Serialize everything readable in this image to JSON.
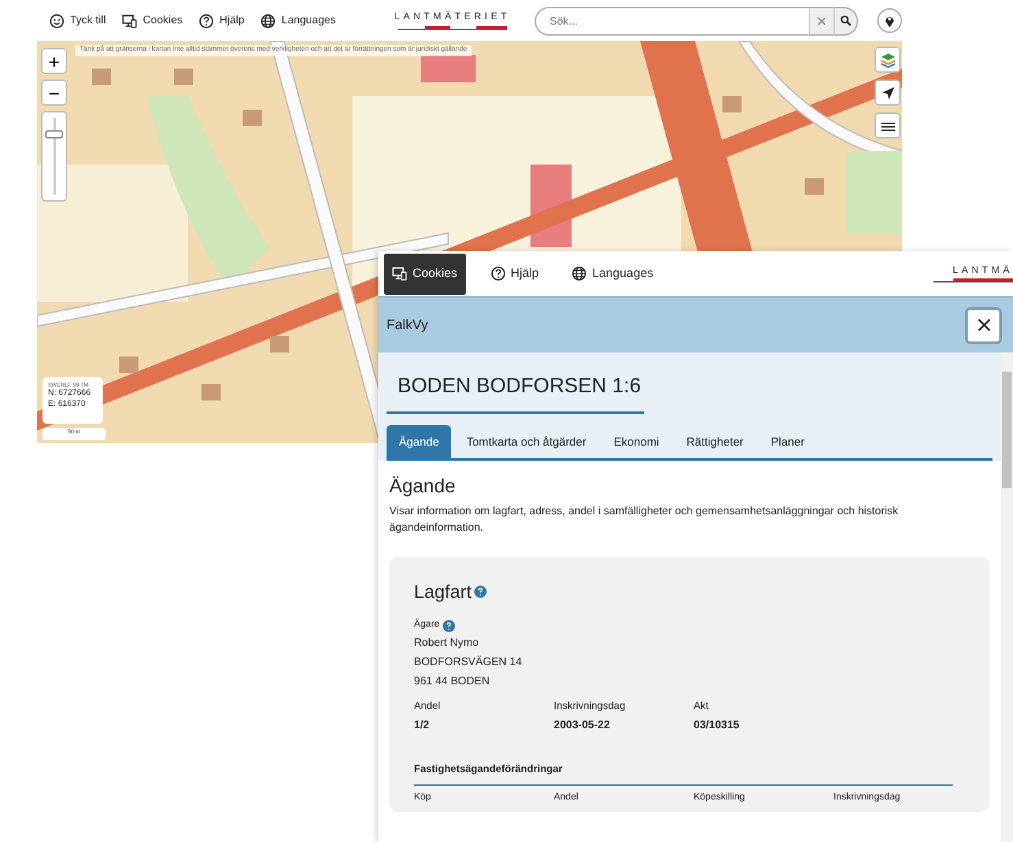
{
  "topbar": {
    "links": [
      {
        "label": "Tyck till"
      },
      {
        "label": "Cookies"
      },
      {
        "label": "Hjälp"
      },
      {
        "label": "Languages"
      }
    ],
    "logo": "LANTMÄTERIET",
    "search": {
      "placeholder": "Sök..."
    }
  },
  "map": {
    "kind": "picture",
    "notice": "Tänk på att gränserna i kartan inte alltid stämmer överens med verkligheten och att det är förrättningen som är juridiskt gällande",
    "zoom_in": "+",
    "zoom_out": "−",
    "zoom": {
      "level": 0.82
    },
    "coords": {
      "system": "SWEREF 99 TM",
      "north": "N: 6727666",
      "east": "E:  616370"
    },
    "scale": "50 m"
  },
  "panel": {
    "toolbar": [
      {
        "label": "Cookies",
        "selected": true
      },
      {
        "label": "Hjälp",
        "selected": false
      },
      {
        "label": "Languages",
        "selected": false
      }
    ],
    "logo": "LANTMÄ",
    "title": "FalkVy",
    "property": "BODEN BODFORSEN 1:6",
    "tabs": [
      {
        "label": "Ägande",
        "selected": true
      },
      {
        "label": "Tomtkarta och åtgärder",
        "selected": false
      },
      {
        "label": "Ekonomi",
        "selected": false
      },
      {
        "label": "Rättigheter",
        "selected": false
      },
      {
        "label": "Planer",
        "selected": false
      }
    ],
    "heading": "Ägande",
    "description": "Visar information om lagfart, adress, andel i samfälligheter och gemensamhetsanläggningar och historisk ägandeinformation.",
    "lagfart": {
      "title": "Lagfart",
      "owner_label": "Ägare",
      "owner_lines": [
        "Robert Nymo",
        "BODFORSVÄGEN 14",
        "961 44 BODEN"
      ],
      "fields": [
        {
          "label": "Andel",
          "value": "1/2"
        },
        {
          "label": "Inskrivningsdag",
          "value": "2003-05-22"
        },
        {
          "label": "Akt",
          "value": "03/10315"
        }
      ],
      "changes_title": "Fastighetsägandeförändringar",
      "changes_columns": [
        "Köp",
        "Andel",
        "Köpeskilling",
        "Inskrivningsdag"
      ]
    }
  }
}
